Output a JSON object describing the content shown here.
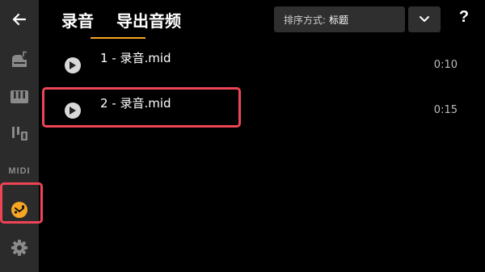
{
  "sidebar": {
    "items": [
      {
        "icon": "back-arrow-icon"
      },
      {
        "icon": "grand-piano-icon"
      },
      {
        "icon": "piano-keys-icon"
      },
      {
        "icon": "mixer-icon"
      },
      {
        "icon": "midi-icon",
        "label": "MIDI"
      },
      {
        "icon": "recordings-icon",
        "active": true
      },
      {
        "icon": "settings-gear-icon"
      }
    ]
  },
  "tabs": [
    {
      "label": "录音",
      "active": true
    },
    {
      "label": "导出音频",
      "active": false
    }
  ],
  "sort": {
    "label": "排序方式:",
    "value": "标题"
  },
  "help": {
    "label": "?"
  },
  "recordings": [
    {
      "title": "1 - 录音.mid",
      "duration": "0:10"
    },
    {
      "title": "2 - 录音.mid",
      "duration": "0:15",
      "highlighted": true
    }
  ],
  "colors": {
    "accent": "#f5a623",
    "highlight": "#ee4455",
    "sidebar": "#2b2b2b"
  }
}
